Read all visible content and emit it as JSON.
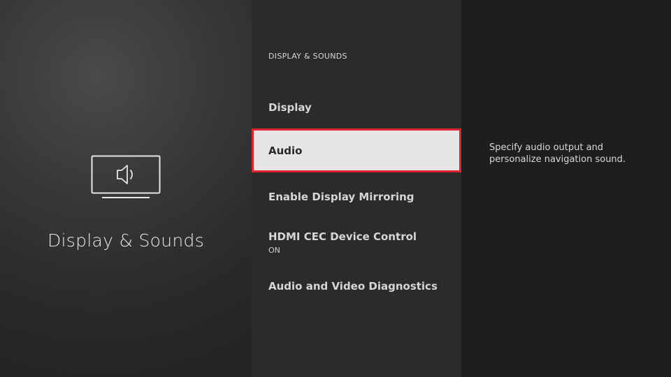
{
  "category": {
    "title": "Display & Sounds",
    "icon": "tv-speaker-icon"
  },
  "menu": {
    "header": "DISPLAY & SOUNDS",
    "items": [
      {
        "label": "Display",
        "sub": ""
      },
      {
        "label": "Audio",
        "sub": "",
        "selected": true
      },
      {
        "label": "Enable Display Mirroring",
        "sub": ""
      },
      {
        "label": "HDMI CEC Device Control",
        "sub": "ON"
      },
      {
        "label": "Audio and Video Diagnostics",
        "sub": ""
      }
    ]
  },
  "details": {
    "description": "Specify audio output and personalize navigation sound."
  },
  "colors": {
    "selection_border": "#e0262d",
    "selection_fill": "#e6e6e6"
  }
}
